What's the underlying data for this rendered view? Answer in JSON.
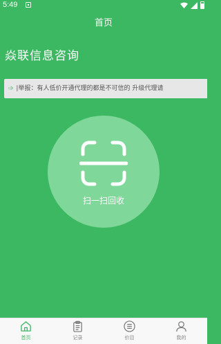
{
  "status_bar": {
    "time": "5:49"
  },
  "header": {
    "title": "首页"
  },
  "company": {
    "name": "焱联信息咨询"
  },
  "notice": {
    "text": "|举报：有人低价开通代理的都是不可信的 升级代理请"
  },
  "scan": {
    "label": "扫一扫回收"
  },
  "tabs": [
    {
      "label": "首页",
      "icon": "home-icon",
      "active": true
    },
    {
      "label": "记录",
      "icon": "clipboard-icon",
      "active": false
    },
    {
      "label": "价目",
      "icon": "price-list-icon",
      "active": false
    },
    {
      "label": "我的",
      "icon": "user-icon",
      "active": false
    }
  ],
  "colors": {
    "primary": "#3cb862",
    "scan_circle": "#7fd79a",
    "notice_bg": "#e7e7e7",
    "tab_bg": "#f8f8f8"
  }
}
